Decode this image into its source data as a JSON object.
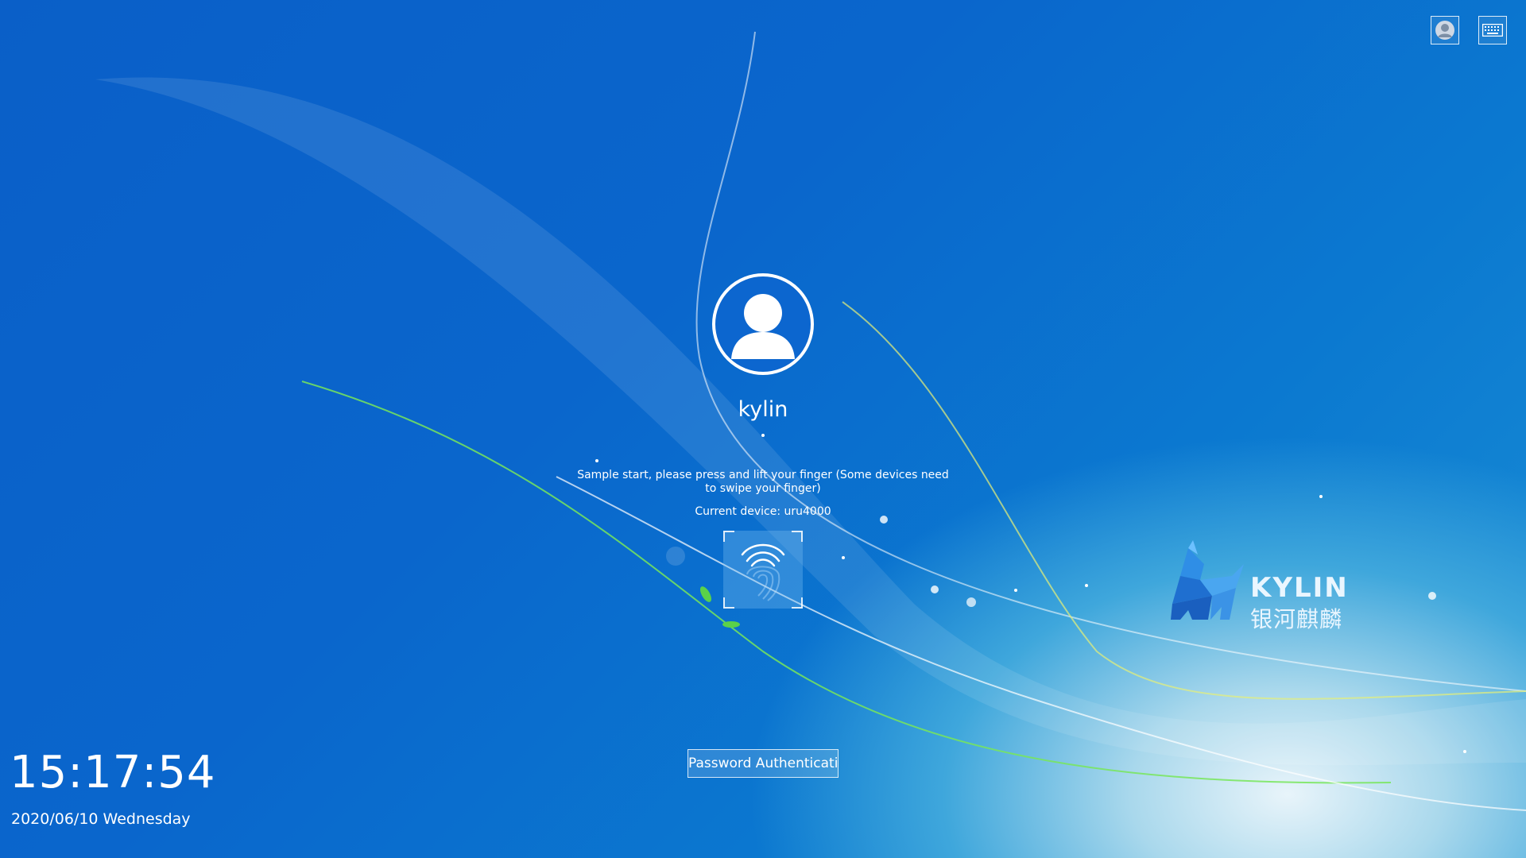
{
  "user": {
    "name": "kylin"
  },
  "auth": {
    "prompt": "Sample start, please press and lift your finger (Some devices need to swipe your finger)",
    "device": "Current device: uru4000",
    "password_button": "Password Authentication"
  },
  "clock": {
    "time": "15:17:54",
    "date": "2020/06/10 Wednesday"
  },
  "brand": {
    "name_en": "KYLIN",
    "name_cn": "银河麒麟"
  },
  "top_buttons": [
    {
      "icon": "user-icon"
    },
    {
      "icon": "keyboard-icon"
    }
  ]
}
